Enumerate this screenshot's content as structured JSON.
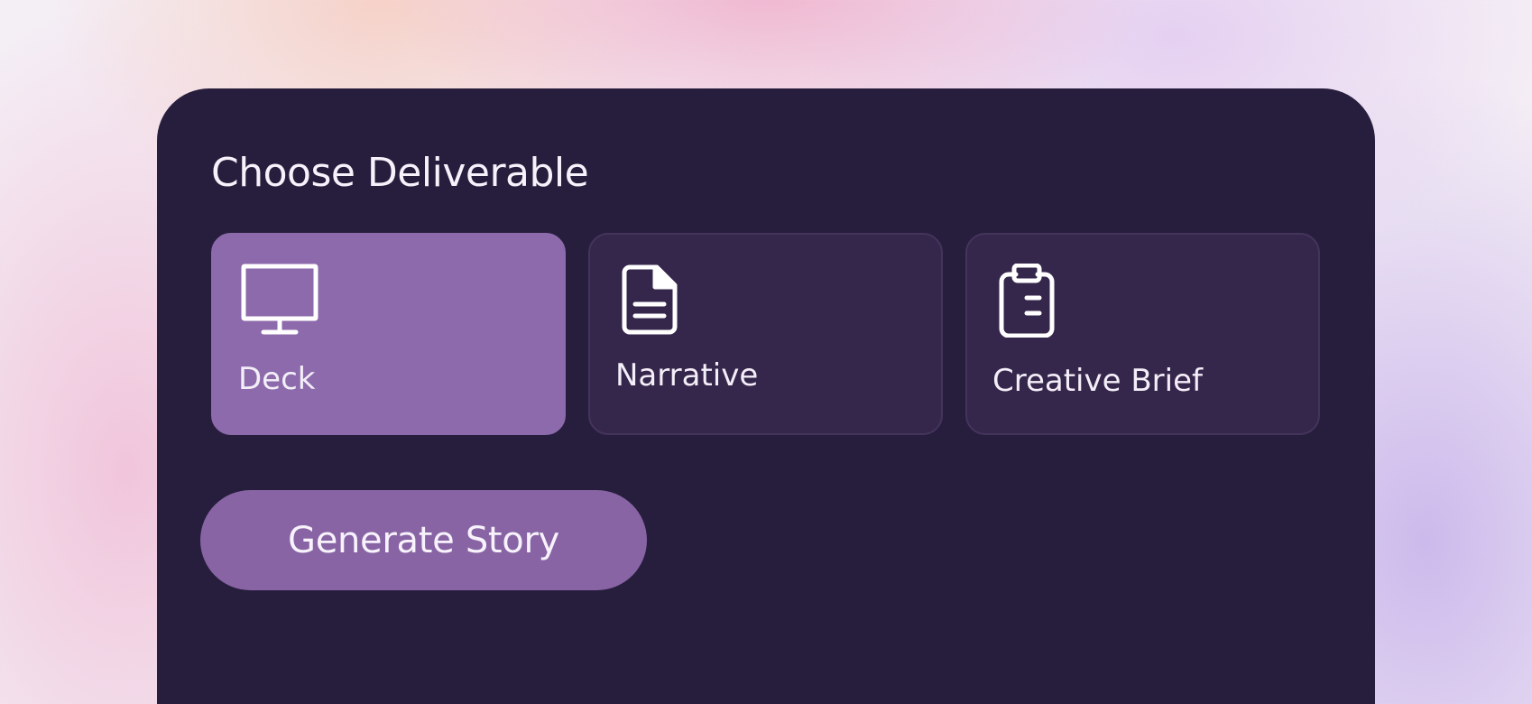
{
  "panel": {
    "title": "Choose Deliverable"
  },
  "deliverables": [
    {
      "label": "Deck",
      "icon": "monitor-icon",
      "selected": true
    },
    {
      "label": "Narrative",
      "icon": "document-icon",
      "selected": false
    },
    {
      "label": "Creative Brief",
      "icon": "clipboard-icon",
      "selected": false
    }
  ],
  "actions": {
    "generate_label": "Generate Story"
  },
  "colors": {
    "panel_bg": "#271e3d",
    "card_bg": "#35264b",
    "selected_card_bg": "#8c6aab",
    "button_bg": "#8864a4",
    "text": "#f3eef8"
  }
}
